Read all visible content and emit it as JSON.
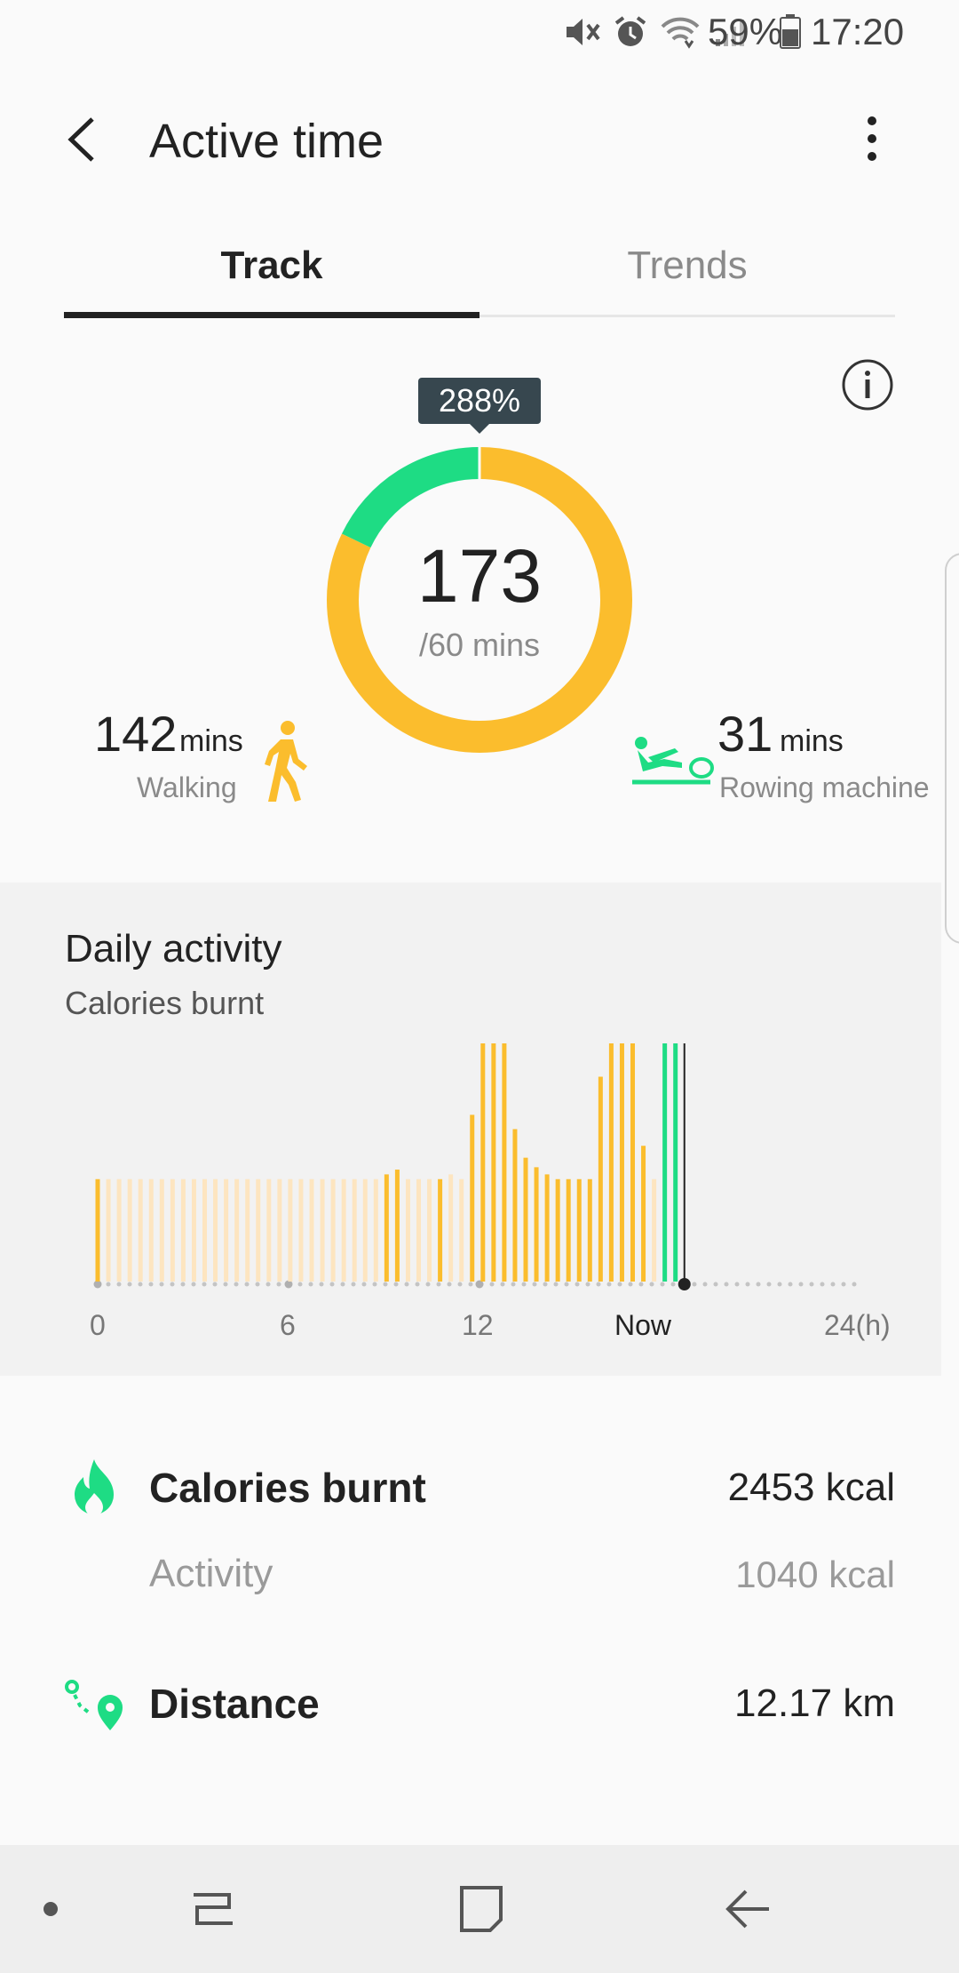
{
  "status_bar": {
    "battery": "59%",
    "time": "17:20",
    "icons": [
      "mute-icon",
      "alarm-icon",
      "wifi-icon",
      "signal-icon",
      "battery-icon"
    ]
  },
  "app_bar": {
    "title": "Active time",
    "back_icon": "chevron-left-icon",
    "more_icon": "more-vertical-icon"
  },
  "tabs": [
    {
      "label": "Track",
      "selected": true
    },
    {
      "label": "Trends",
      "selected": false
    }
  ],
  "summary": {
    "percent_badge": "288%",
    "total": "173",
    "goal": "/60 mins",
    "walking": {
      "value": "142",
      "unit": "mins",
      "label": "Walking"
    },
    "rowing": {
      "value": "31",
      "unit": "mins",
      "label": "Rowing machine"
    },
    "ring_fraction_walking": 0.821,
    "ring_fraction_rowing": 0.179,
    "colors": {
      "walking": "#fbbd2d",
      "rowing": "#1edc84"
    }
  },
  "daily_activity": {
    "title": "Daily activity",
    "subtitle": "Calories burnt",
    "x_ticks": [
      "0",
      "6",
      "12",
      "Now",
      "24(h)"
    ],
    "bars_relative": [
      0.43,
      0.43,
      0.43,
      0.43,
      0.43,
      0.43,
      0.43,
      0.43,
      0.43,
      0.43,
      0.43,
      0.43,
      0.43,
      0.43,
      0.43,
      0.43,
      0.43,
      0.43,
      0.43,
      0.43,
      0.43,
      0.43,
      0.43,
      0.43,
      0.43,
      0.43,
      0.43,
      0.45,
      0.47,
      0.43,
      0.43,
      0.43,
      0.43,
      0.45,
      0.43,
      0.7,
      1.0,
      1.0,
      1.0,
      0.64,
      0.52,
      0.48,
      0.45,
      0.43,
      0.43,
      0.43,
      0.43,
      0.86,
      1.0,
      1.0,
      1.0,
      0.57,
      0.43,
      1.0,
      1.0
    ],
    "bar_kinds": [
      "a",
      "f",
      "f",
      "f",
      "f",
      "f",
      "f",
      "f",
      "f",
      "f",
      "f",
      "f",
      "f",
      "f",
      "f",
      "f",
      "f",
      "f",
      "f",
      "f",
      "f",
      "f",
      "f",
      "f",
      "f",
      "f",
      "f",
      "a",
      "a",
      "f",
      "f",
      "f",
      "a",
      "f",
      "f",
      "a",
      "a",
      "a",
      "a",
      "a",
      "a",
      "a",
      "a",
      "a",
      "a",
      "a",
      "a",
      "a",
      "a",
      "a",
      "a",
      "a",
      "f",
      "g",
      "g"
    ]
  },
  "metrics": {
    "calories": {
      "label": "Calories burnt",
      "value": "2453 kcal",
      "sub_label": "Activity",
      "sub_value": "1040 kcal",
      "icon": "flame-icon"
    },
    "distance": {
      "label": "Distance",
      "value": "12.17 km",
      "icon": "route-pin-icon"
    }
  },
  "nav_bar": {
    "buttons": [
      "dot-icon",
      "recents-icon",
      "home-icon",
      "back-arrow-icon"
    ]
  }
}
